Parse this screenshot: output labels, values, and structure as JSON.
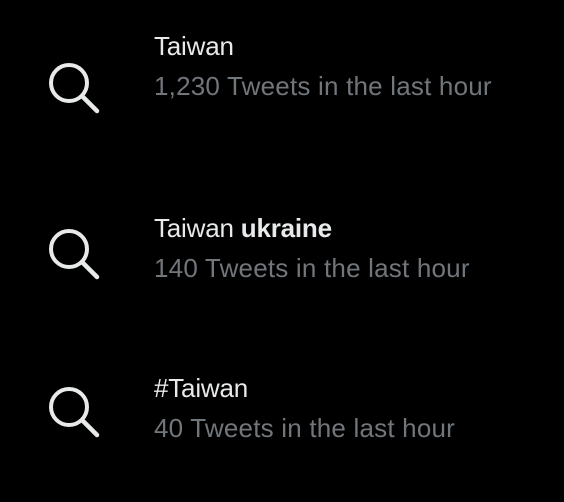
{
  "search_suggestions": [
    {
      "icon": "search-icon",
      "title": "Taiwan",
      "title_bold": "",
      "meta": "1,230 Tweets in the last hour"
    },
    {
      "icon": "search-icon",
      "title": "Taiwan ",
      "title_bold": "ukraine",
      "meta": "140 Tweets in the last hour"
    },
    {
      "icon": "search-icon",
      "title": "#Taiwan",
      "title_bold": "",
      "meta": "40 Tweets in the last hour"
    }
  ],
  "colors": {
    "background": "#000000",
    "primary_text": "#e7e9ea",
    "secondary_text": "#71767b"
  }
}
